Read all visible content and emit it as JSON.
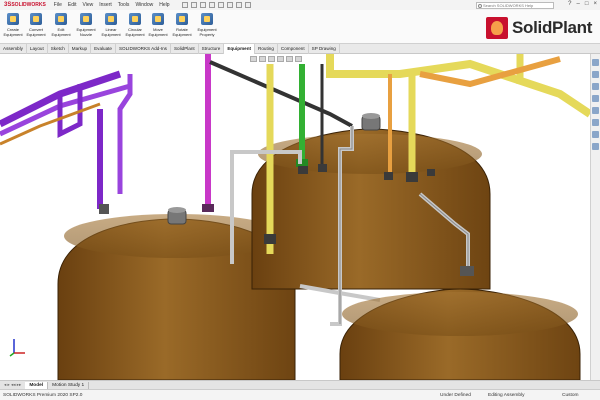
{
  "app": {
    "logo_text": "SOLIDWORKS",
    "menu": [
      "File",
      "Edit",
      "View",
      "Insert",
      "Tools",
      "Window",
      "Help"
    ],
    "search_placeholder": "Search SOLIDWORKS Help"
  },
  "ribbon": {
    "buttons": [
      {
        "label": "Create\nEquipment",
        "icon": "create-equipment-icon"
      },
      {
        "label": "Convert\nEquipment",
        "icon": "convert-equipment-icon"
      },
      {
        "label": "Edit\nEquipment",
        "icon": "edit-equipment-icon"
      },
      {
        "label": "Equipment\nNozzle",
        "icon": "equipment-nozzle-icon"
      },
      {
        "label": "Linear\nEquipment",
        "icon": "linear-equipment-icon"
      },
      {
        "label": "Circular\nEquipment",
        "icon": "circular-equipment-icon"
      },
      {
        "label": "Move\nEquipment",
        "icon": "move-equipment-icon"
      },
      {
        "label": "Rotate\nEquipment",
        "icon": "rotate-equipment-icon"
      },
      {
        "label": "Equipment\nProperty",
        "icon": "equipment-property-icon"
      }
    ],
    "brand": "SolidPlant"
  },
  "tabs": [
    "Assembly",
    "Layout",
    "Sketch",
    "Markup",
    "Evaluate",
    "SOLIDWORKS Add-Ins",
    "SolidPlant",
    "Structure",
    "Equipment",
    "Routing",
    "Component",
    "SP Drawing"
  ],
  "active_tab": "Equipment",
  "bottom_tabs": [
    "Model",
    "Motion Study 1"
  ],
  "active_bottom_tab": "Model",
  "status": {
    "product": "SOLIDWORKS Premium 2020 SP2.0",
    "state": "Under Defined",
    "mode": "Editing Assembly",
    "units": "Custom"
  },
  "colors": {
    "tank": "#8a5a1c",
    "pipe_purple": "#8a2be2",
    "pipe_yellow": "#e8e060",
    "pipe_green": "#3cbf3c",
    "pipe_orange": "#e8a040",
    "pipe_magenta": "#d040d0",
    "brand_red": "#c8102e"
  }
}
